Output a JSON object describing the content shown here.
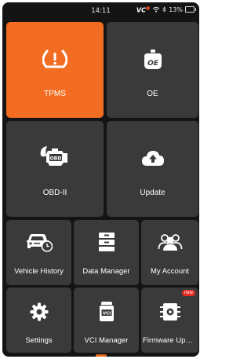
{
  "status_bar": {
    "time": "14:11",
    "vci_label": "VC",
    "battery": "13%"
  },
  "tiles": {
    "tpms": {
      "label": "TPMS",
      "icon": "tpms-warning-icon"
    },
    "oe": {
      "label": "OE",
      "icon": "oe-icon"
    },
    "obd2": {
      "label": "OBD-II",
      "icon": "engine-obd-icon"
    },
    "update": {
      "label": "Update",
      "icon": "cloud-upload-icon"
    },
    "vehicle_history": {
      "label": "Vehicle History",
      "icon": "car-clock-icon"
    },
    "data_manager": {
      "label": "Data Manager",
      "icon": "folder-cabinet-icon"
    },
    "my_account": {
      "label": "My Account",
      "icon": "users-icon"
    },
    "settings": {
      "label": "Settings",
      "icon": "gear-icon"
    },
    "vci_manager": {
      "label": "VCI Manager",
      "icon": "vci-device-icon",
      "icon_text": "VCI"
    },
    "firmware_update": {
      "label": "Firmware Upd…",
      "icon": "chip-icon",
      "badge": "new"
    }
  },
  "colors": {
    "background": "#141414",
    "tile": "#3a3a3a",
    "active_tile": "#f26d21",
    "badge": "#e42a21"
  }
}
